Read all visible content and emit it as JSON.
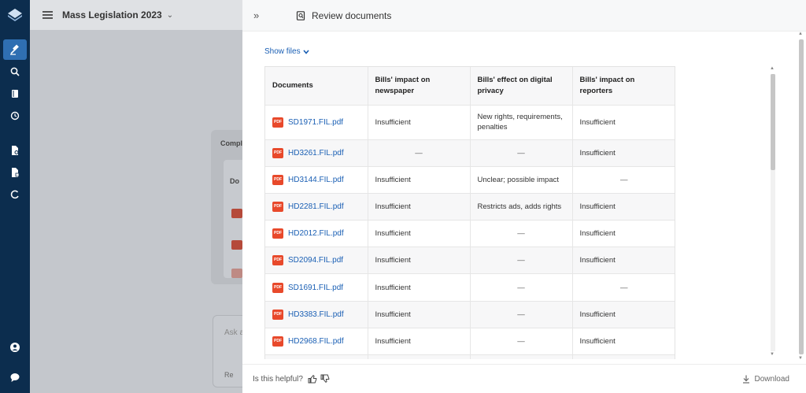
{
  "project": {
    "title": "Mass Legislation 2023"
  },
  "background": {
    "card_label": "Compl",
    "inner_label": "Do",
    "ask_placeholder": "Ask a",
    "ask_button": "Re"
  },
  "drawer": {
    "title": "Review documents",
    "show_files": "Show files",
    "helpful_label": "Is this helpful?",
    "download_label": "Download"
  },
  "table": {
    "headers": [
      "Documents",
      "Bills' impact on newspaper",
      "Bills' effect on digital privacy",
      "Bills' impact on reporters"
    ],
    "rows": [
      {
        "doc": "SD1971.FIL.pdf",
        "c1": "Insufficient",
        "c2": "New rights, requirements, penalties",
        "c3": "Insufficient"
      },
      {
        "doc": "HD3261.FIL.pdf",
        "c1": "—",
        "c2": "—",
        "c3": "Insufficient"
      },
      {
        "doc": "HD3144.FIL.pdf",
        "c1": "Insufficient",
        "c2": "Unclear; possible impact",
        "c3": "—"
      },
      {
        "doc": "HD2281.FIL.pdf",
        "c1": "Insufficient",
        "c2": "Restricts ads, adds rights",
        "c3": "Insufficient"
      },
      {
        "doc": "HD2012.FIL.pdf",
        "c1": "Insufficient",
        "c2": "—",
        "c3": "Insufficient"
      },
      {
        "doc": "SD2094.FIL.pdf",
        "c1": "Insufficient",
        "c2": "—",
        "c3": "Insufficient"
      },
      {
        "doc": "SD1691.FIL.pdf",
        "c1": "Insufficient",
        "c2": "—",
        "c3": "—"
      },
      {
        "doc": "HD3383.FIL.pdf",
        "c1": "Insufficient",
        "c2": "—",
        "c3": "Insufficient"
      },
      {
        "doc": "HD2968.FIL.pdf",
        "c1": "Insufficient",
        "c2": "—",
        "c3": "Insufficient"
      },
      {
        "doc": "",
        "c1": "",
        "c2": "",
        "c3": ""
      }
    ]
  },
  "pdf_badge": "PDF",
  "colors": {
    "sidebar": "#0c2d4e",
    "active": "#2f6fb2",
    "link": "#1a5fb4",
    "pdf": "#e8492b"
  }
}
